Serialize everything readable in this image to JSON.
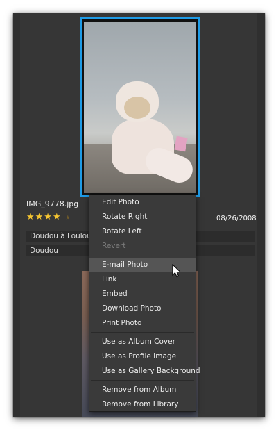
{
  "photo": {
    "filename": "IMG_9778.jpg",
    "rating": 4,
    "rating_max": 5,
    "stars_filled": "★★★★",
    "star_empty": "★",
    "date": "08/26/2008",
    "album": "Doudou à Loulout",
    "tag": "Doudou"
  },
  "menu": {
    "items": [
      {
        "label": "Edit Photo",
        "enabled": true
      },
      {
        "label": "Rotate Right",
        "enabled": true
      },
      {
        "label": "Rotate Left",
        "enabled": true
      },
      {
        "label": "Revert",
        "enabled": false
      },
      {
        "label": "E-mail Photo",
        "enabled": true,
        "hover": true
      },
      {
        "label": "Link",
        "enabled": true
      },
      {
        "label": "Embed",
        "enabled": true
      },
      {
        "label": "Download Photo",
        "enabled": true
      },
      {
        "label": "Print Photo",
        "enabled": true
      },
      {
        "label": "Use as Album Cover",
        "enabled": true
      },
      {
        "label": "Use as Profile Image",
        "enabled": true
      },
      {
        "label": "Use as Gallery Background",
        "enabled": true
      },
      {
        "label": "Remove from Album",
        "enabled": true
      },
      {
        "label": "Remove from Library",
        "enabled": true
      }
    ]
  },
  "colors": {
    "panel_bg": "#363636",
    "selection_border": "#1e9be6",
    "star": "#f5c531",
    "menu_bg": "#3a3a3a",
    "menu_hover": "#555555"
  }
}
